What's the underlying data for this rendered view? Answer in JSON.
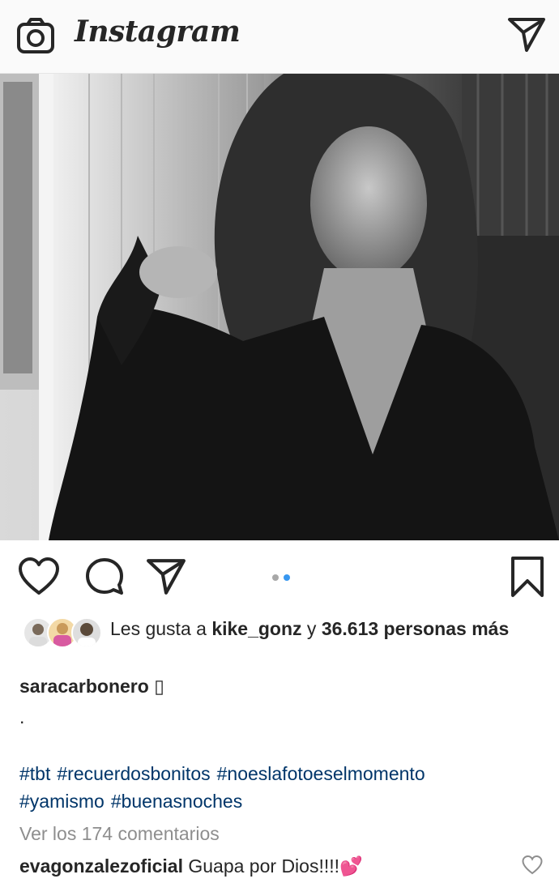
{
  "header": {
    "logo": "Instagram",
    "icons": [
      "camera-icon",
      "direct-message-icon"
    ]
  },
  "post": {
    "carousel": {
      "count": 2,
      "active_index": 1
    },
    "actions": [
      "heart-icon",
      "comment-icon",
      "share-icon",
      "bookmark-icon"
    ],
    "likes": {
      "prefix": "Les gusta a",
      "user": "kike_gonz",
      "joiner": "y",
      "others": "36.613 personas más"
    },
    "caption": {
      "user": "saracarbonero",
      "text": "▯",
      "line2": "."
    },
    "hashtags": [
      "#tbt",
      "#recuerdosbonitos",
      "#noeslafotoeselmomento",
      "#yamismo",
      "#buenasnoches"
    ],
    "view_comments": "Ver los 174 comentarios",
    "first_comment": {
      "user": "evagonzalezoficial",
      "text": "Guapa por Dios!!!!💕"
    }
  },
  "colors": {
    "text": "#262626",
    "hashtag": "#003569",
    "muted": "#8e8e8e",
    "carousel_active": "#3897f0",
    "carousel_inactive": "#a8a8a8"
  }
}
